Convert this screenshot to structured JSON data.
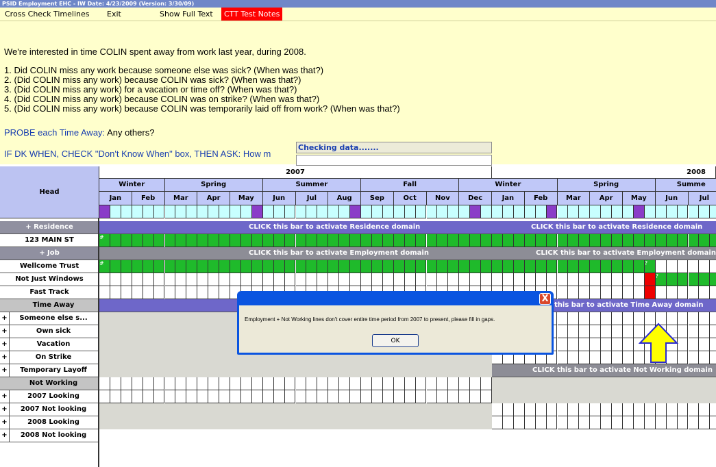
{
  "window": {
    "title": "PSID Employment EHC - IW Date: 4/23/2009 (Version: 3/30/09)"
  },
  "menu": {
    "cross_check": "Cross Check Timelines",
    "exit": "Exit",
    "show_full_text": "Show Full Text",
    "ctt_notes": "CTT Test Notes"
  },
  "question": {
    "intro": "We're interested in time COLIN spent away from work last year, during 2008.",
    "q1": "1. Did COLIN miss any work because someone else was sick? (When was that?)",
    "q2": "2. (Did COLIN miss any work) because COLIN was sick? (When was that?)",
    "q3": "3. (Did COLIN miss any work) for a vacation or time off? (When was that?)",
    "q4": "4. (Did COLIN miss any work) because COLIN was on strike? (When was that?)",
    "q5": "5. (Did COLIN miss any work) because COLIN was temporarily laid off from work? (When was that?)",
    "probe_label": "PROBE each Time Away:",
    "probe_text": " Any others?",
    "dk_text": "IF DK WHEN, CHECK \"Don't Know When\" box, THEN ASK:",
    "dk_tail": " How m"
  },
  "checking": {
    "label": "Checking data......."
  },
  "grid": {
    "head_label": "Head",
    "years": [
      "2007",
      "2008"
    ],
    "seasons_2007": [
      "Winter",
      "Spring",
      "Summer",
      "Fall"
    ],
    "seasons_2008": [
      "Winter",
      "Spring",
      "Summe"
    ],
    "months_2007": [
      "Jan",
      "Feb",
      "Mar",
      "Apr",
      "May",
      "Jun",
      "Jul",
      "Aug",
      "Sep",
      "Oct",
      "Nov",
      "Dec"
    ],
    "months_2008": [
      "Jan",
      "Feb",
      "Mar",
      "Apr",
      "May",
      "Jun",
      "Jul"
    ],
    "rows": {
      "residence": "+ Residence",
      "address": "123 MAIN ST",
      "job": "+ Job",
      "job1": "Wellcome Trust",
      "job2": "Not Just Windows",
      "job3": "Fast Track",
      "time_away": "Time Away",
      "ta1": "Someone else s...",
      "ta2": "Own sick",
      "ta3": "Vacation",
      "ta4": "On Strike",
      "ta5": "Temporary Layoff",
      "not_working": "Not Working",
      "nw1": "2007 Looking",
      "nw2": "2007 Not looking",
      "nw3": "2008 Looking",
      "nw4": "2008 Not looking",
      "plus": "+"
    },
    "bars": {
      "residence": "CLICK this bar to activate Residence domain",
      "employment": "CLICK this bar to activate Employment domain",
      "employment_2008": "CLICK this bar to activate Employment domain",
      "time_away_partial": "this bar to activate Time Away domain",
      "not_working": "CLICK this bar to activate Not Working domain"
    },
    "marks": {
      "hash": "#",
      "question": "?"
    }
  },
  "dialog": {
    "message": "Employment + Not Working lines don't cover entire time period from 2007 to present, please fill in gaps.",
    "ok": "OK",
    "close": "X"
  },
  "colors": {
    "accent": "#ffffcc",
    "green": "#1fba2b",
    "red": "#ee0000",
    "arrow": "#ffff00"
  }
}
